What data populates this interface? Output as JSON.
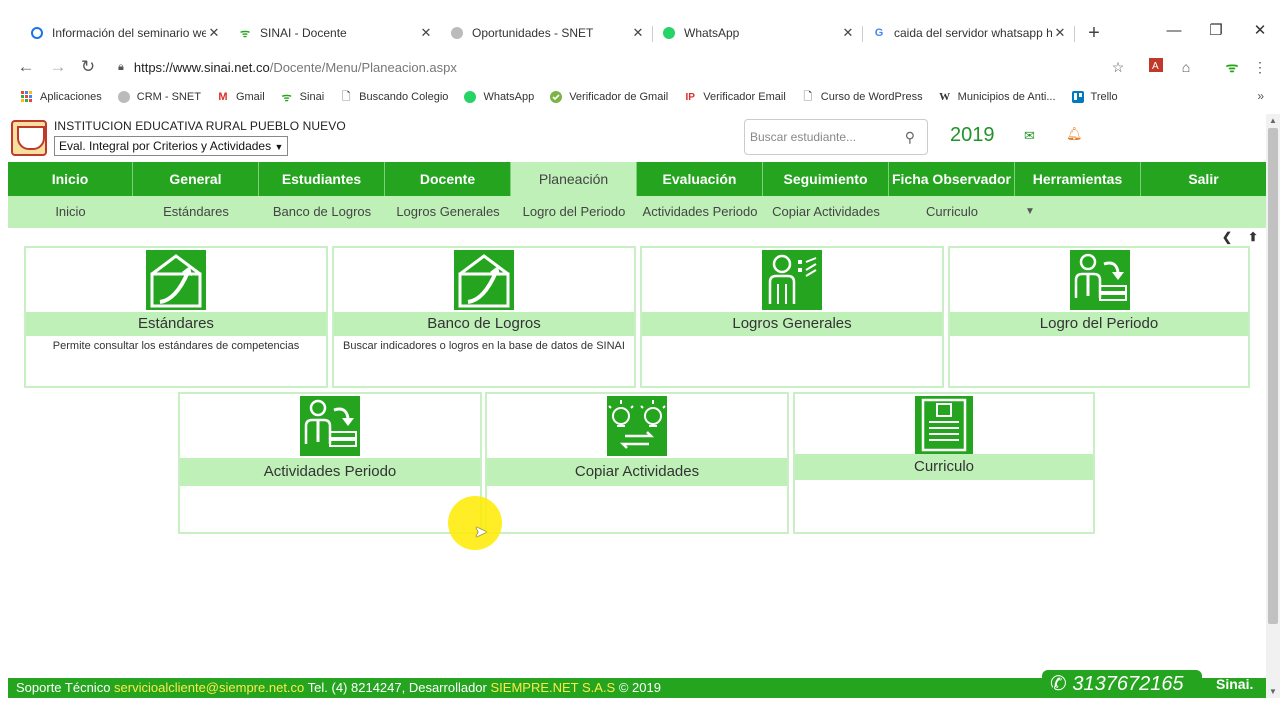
{
  "browser": {
    "tabs": [
      {
        "title": "Información del seminario web",
        "icon": "circle-blue-icon"
      },
      {
        "title": "SINAI - Docente",
        "icon": "sinai-icon"
      },
      {
        "title": "Oportunidades - SNET",
        "icon": "snet-icon"
      },
      {
        "title": "WhatsApp",
        "icon": "whatsapp-icon"
      },
      {
        "title": "caida del servidor whatsapp ho",
        "icon": "google-icon"
      }
    ],
    "url_host": "https://www.sinai.net.co",
    "url_path": "/Docente/Menu/Planeacion.aspx",
    "bookmarks": [
      "Aplicaciones",
      "CRM - SNET",
      "Gmail",
      "Sinai",
      "Buscando Colegio",
      "WhatsApp",
      "Verificador de Gmail",
      "Verificador Email",
      "Curso de WordPress",
      "Municipios de Anti...",
      "Trello"
    ],
    "bookmarks_more": "»"
  },
  "header": {
    "school": "INSTITUCION EDUCATIVA RURAL PUEBLO NUEVO",
    "eval_select": "Eval. Integral por Criterios y Actividades",
    "search_placeholder": "Buscar estudiante...",
    "year": "2019"
  },
  "main_nav": [
    "Inicio",
    "General",
    "Estudiantes",
    "Docente",
    "Planeación",
    "Evaluación",
    "Seguimiento",
    "Ficha Observador",
    "Herramientas",
    "Salir"
  ],
  "sub_nav": [
    "Inicio",
    "Estándares",
    "Banco de Logros",
    "Logros Generales",
    "Logro del Periodo",
    "Actividades Periodo",
    "Copiar Actividades",
    "Curriculo"
  ],
  "cards": [
    {
      "title": "Estándares",
      "desc": "Permite consultar los estándares de competencias",
      "icon": "chart-up-icon"
    },
    {
      "title": "Banco de Logros",
      "desc": "Buscar indicadores o logros en la base de datos de SINAI",
      "icon": "chart-up-icon"
    },
    {
      "title": "Logros Generales",
      "desc": "",
      "icon": "person-checklist-icon"
    },
    {
      "title": "Logro del Periodo",
      "desc": "",
      "icon": "person-arrow-icon"
    },
    {
      "title": "Actividades Periodo",
      "desc": "",
      "icon": "person-arrow-icon"
    },
    {
      "title": "Copiar Actividades",
      "desc": "",
      "icon": "bulb-exchange-icon"
    },
    {
      "title": "Curriculo",
      "desc": "",
      "icon": "document-icon"
    }
  ],
  "footer": {
    "prefix": "Soporte Técnico ",
    "email": "servicioalcliente@siempre.net.co",
    "mid": " Tel. (4) 8214247, Desarrollador ",
    "company": "SIEMPRE.NET S.A.S",
    "suffix": " © 2019",
    "whatsapp": "3137672165",
    "brand": "Sinai."
  },
  "colors": {
    "green": "#25a51f",
    "light_green": "#bff0b8",
    "accent_year": "#22922a"
  }
}
